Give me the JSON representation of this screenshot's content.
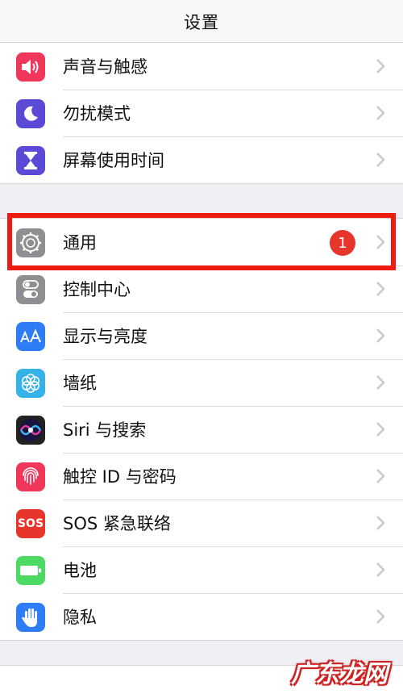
{
  "nav": {
    "title": "设置"
  },
  "group1": [
    {
      "label": "声音与触感",
      "icon": "speaker-icon",
      "color": "#f0365a"
    },
    {
      "label": "勿扰模式",
      "icon": "moon-icon",
      "color": "#5b4ad6"
    },
    {
      "label": "屏幕使用时间",
      "icon": "hourglass-icon",
      "color": "#5b4ad6"
    }
  ],
  "group2": [
    {
      "label": "通用",
      "icon": "gear-icon",
      "color": "#8e8e93",
      "badge": "1"
    },
    {
      "label": "控制中心",
      "icon": "toggle-icon",
      "color": "#8e8e93"
    },
    {
      "label": "显示与亮度",
      "icon": "text-size-icon",
      "color": "#2f7df6"
    },
    {
      "label": "墙纸",
      "icon": "flower-icon",
      "color": "#35b3e8"
    },
    {
      "label": "Siri 与搜索",
      "icon": "siri-icon",
      "color": "#222222"
    },
    {
      "label": "触控 ID 与密码",
      "icon": "fingerprint-icon",
      "color": "#f0365a"
    },
    {
      "label": "SOS 紧急联络",
      "icon": "sos-icon",
      "color": "#e8352b",
      "icon_text": "SOS"
    },
    {
      "label": "电池",
      "icon": "battery-icon",
      "color": "#4cd964"
    },
    {
      "label": "隐私",
      "icon": "hand-icon",
      "color": "#2f7df6"
    }
  ],
  "watermark": "广东龙网",
  "colors": {
    "highlight": "#ef1a10",
    "badge": "#e8352b",
    "chevron": "#c7c7cc"
  }
}
